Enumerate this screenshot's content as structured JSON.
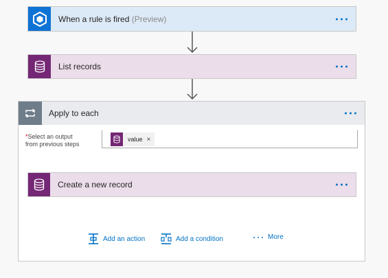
{
  "trigger": {
    "title": "When a rule is fired",
    "subtitle": "(Preview)"
  },
  "list_records": {
    "title": "List records"
  },
  "apply_to_each": {
    "title": "Apply to each",
    "field": {
      "required_marker": "*",
      "label_line1": "Select an output",
      "label_line2": "from previous steps",
      "token": "value",
      "token_remove": "×"
    },
    "inner_action": {
      "title": "Create a new record"
    },
    "footer": {
      "add_action": "Add an action",
      "add_condition": "Add a condition",
      "more": "More"
    }
  },
  "colors": {
    "trigger_bg": "#dce9f6",
    "trigger_icon": "#0f73d5",
    "dynamics_bg": "#ebdde9",
    "dynamics_icon": "#742774",
    "loop_header_bg": "#e9ebee",
    "loop_icon": "#6f7c8a",
    "link": "#0072c6"
  },
  "icons": {
    "trigger": "hexagon-cube-icon",
    "dynamics": "database-icon",
    "loop": "loop-icon",
    "add_action": "add-action-icon",
    "add_condition": "add-condition-icon"
  }
}
